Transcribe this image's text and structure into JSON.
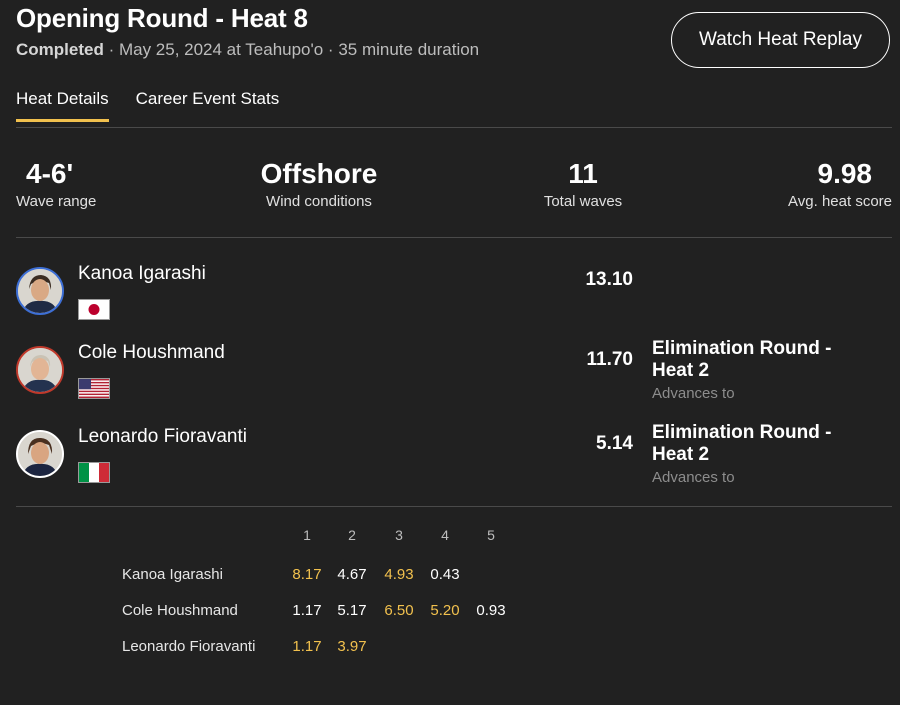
{
  "header": {
    "title": "Opening Round - Heat 8",
    "status": "Completed",
    "details": " · May 25, 2024 at Teahupo'o · 35 minute duration",
    "replay_label": "Watch Heat Replay"
  },
  "tabs": [
    {
      "label": "Heat Details",
      "active": true
    },
    {
      "label": "Career Event Stats",
      "active": false
    }
  ],
  "stats": [
    {
      "value": "4-6'",
      "label": "Wave range"
    },
    {
      "value": "Offshore",
      "label": "Wind conditions"
    },
    {
      "value": "11",
      "label": "Total waves"
    },
    {
      "value": "9.98",
      "label": "Avg. heat score"
    }
  ],
  "surfers": [
    {
      "name": "Kanoa Igarashi",
      "country": "Japan",
      "score": "13.10",
      "advance_round": "",
      "advance_note": ""
    },
    {
      "name": "Cole Houshmand",
      "country": "USA",
      "score": "11.70",
      "advance_round": "Elimination Round - Heat 2",
      "advance_note": "Advances to"
    },
    {
      "name": "Leonardo Fioravanti",
      "country": "Italy",
      "score": "5.14",
      "advance_round": "Elimination Round - Heat 2",
      "advance_note": "Advances to"
    }
  ],
  "wave_table": {
    "headers": [
      "1",
      "2",
      "3",
      "4",
      "5"
    ],
    "rows": [
      {
        "name": "Kanoa Igarashi",
        "values": [
          "8.17",
          "4.67",
          "4.93",
          "0.43",
          ""
        ],
        "counting": [
          true,
          false,
          true,
          false,
          false
        ]
      },
      {
        "name": "Cole Houshmand",
        "values": [
          "1.17",
          "5.17",
          "6.50",
          "5.20",
          "0.93"
        ],
        "counting": [
          false,
          false,
          true,
          true,
          false
        ]
      },
      {
        "name": "Leonardo Fioravanti",
        "values": [
          "1.17",
          "3.97",
          "",
          "",
          ""
        ],
        "counting": [
          true,
          true,
          false,
          false,
          false
        ]
      }
    ]
  },
  "colors": {
    "background": "#212121",
    "accent": "#f2c14e",
    "avatar_ring_1": "#3d6fd6",
    "avatar_ring_2": "#c0392b",
    "avatar_ring_3": "#ffffff"
  }
}
